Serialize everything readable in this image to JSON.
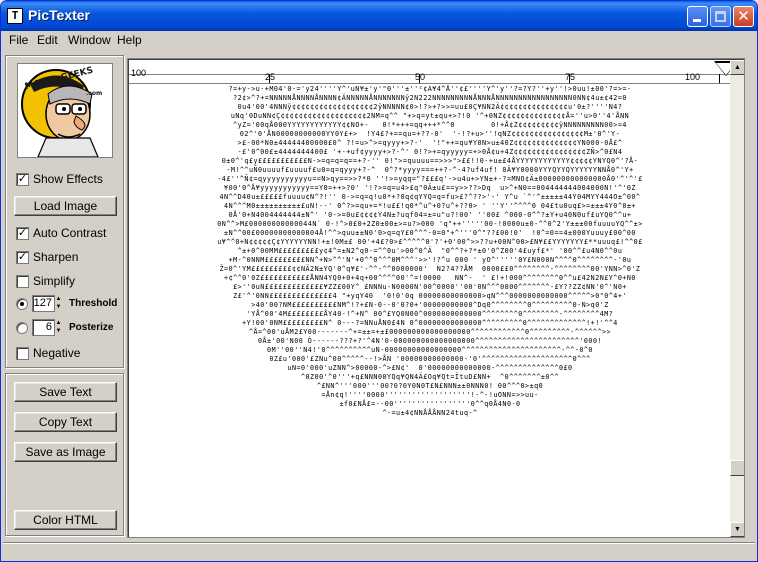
{
  "window": {
    "title": "PicTexter",
    "app_icon_glyph": "T",
    "controls": {
      "close_glyph": "✕"
    }
  },
  "menu": [
    {
      "label": "File"
    },
    {
      "label": "Edit"
    },
    {
      "label": "Window"
    },
    {
      "label": "Help"
    }
  ],
  "logo": {
    "text": "MAJOR GEEKS",
    "suffix": ".com",
    "colors": {
      "ring": "#f2c200",
      "text": "#1a1a1a",
      "face": "#f0c9a0"
    }
  },
  "options": {
    "show_effects": {
      "label": "Show Effects",
      "checked": true
    },
    "load_image": {
      "label": "Load Image"
    },
    "auto_contrast": {
      "label": "Auto Contrast",
      "checked": true
    },
    "sharpen": {
      "label": "Sharpen",
      "checked": true
    },
    "simplify": {
      "label": "Simplify",
      "checked": false
    },
    "threshold": {
      "value": "127",
      "label": "Threshold",
      "selected": true
    },
    "posterize": {
      "value": "6",
      "label": "Posterize",
      "selected": false
    },
    "negative": {
      "label": "Negative",
      "checked": false
    }
  },
  "actions": {
    "save_text": "Save Text",
    "copy_text": "Copy Text",
    "save_as_image": "Save as Image",
    "color_html": "Color HTML"
  },
  "ruler": {
    "labels": [
      "100",
      "25",
      "50",
      "75",
      "100"
    ]
  },
  "ascii_lines": [
    "?=+y->u-+M04'0-='y24''''Y^'uN¥±'y'\"0'''±''²¢Ä¥4^Å''¢£''''Y^'y''?=?Y?''+y''!>0uu!±00'?=>=-",
    "?2¢>^?+=NNNNNÅNNNNÅNNNN¢ÄNNNNNÅNNNNNNNÿ2N222NNNNNNNNNÅNNNÅNNNNNNNNNNNNNNNNN0NN¢4u±¢42=0",
    "0u4'00'4NNNÿ¢¢¢¢¢¢¢¢¢¢¢¢¢¢¢¢¢¢2ÿNNNNN¢0>!?>+?>>=uu£0Ç¥NN2Ä¢¢¢¢¢¢¢¢¢¢¢¢¢¢¢u'0±?''''N4?",
    "uNq'0DuNN¢Ç¢¢¢¢¢¢¢¢¢¢¢¢¢¢¢¢¢¢¢2NM=q^^ \"+>q=yt±qu+>?!0 '^+0NZ¢¢¢¢¢¢¢¢¢¢¢¢¢¢Å=''u>0''4'ÅNN",
    "^yZ='00qÅ000YYYYYYYYYYYY¢¢NO+-   0!*+++=qq+++*^^0        0!+Å¢Z¢¢¢¢¢¢¢¢¢ÿNNNNNNNNN00>=4",
    "02^'0'ÅN00000000000YY0Y£+>  !Y4£?+==qu=+??-0'  '-!?+u>''!qNZ¢¢¢¢¢¢¢¢¢¢¢¢¢¢¢¢M±'0^'Y-",
    ">£-00*N0±44444400000£0^ ?!=u>^>=qyyy+>?-'  '!\"++=qu¥Y0N>u±40Z¢¢¢¢¢¢¢¢¢¢¢¢¢¢YN000-0Å£^",
    "-£'0^00£±4444444400£ '+-+uf¢yyyy+>?-^' 0!?>+=qyyyyy=+>0Å¢u+4Z¢¢¢¢¢¢¢¢¢¢¢¢¢¢¢¢ZÑ>^0£N4",
    "0±0^'q£y£££££££££££N->=q=q=q==+?-'' 0!\">=quuuu==>>>\">££!!0-+u±£4ÅYYYYYYYYYYYY¢¢¢¢¢YNYQ0^'?Å-",
    "-M!^^uÑ0uuuuf£uuuuf£u0=q=qyyy+?-^  0^?*yyyy===++?-^-4?uf4uf! 0Ä¥Y0000YYYQYYQYYYYYYNNÅ0^'Y+",
    "-4£''^Ñ¢=qyyyyyyyyyyu==N>qy==>>?*0 ''!>=yqq=\"?£££q'->u4u+>YN±+-?=MNO¢Ä±000000000000000Å0'^'^'£",
    "¥00'0^Å¥yyyyyyyyyyy==Y0=++>?0' '!?>=q=u4>£q\"0Ä±u£==y>>??>Dq  u>^+N0==004444444004000N!'^'0Z",
    "4N^^D40u±£££££fuuuu¢N^?!'' 0->=q=q!u0*+?0q¢qYYQ=q=fu>£?^??>'-' Y^u `^'^±±±±±44Y04MYY444O±^00^",
    "4N^^^M0±±±±±±±±±±£uN!--' 0^?>=qu+=*!u££!q0*^u^+0?u^+??0> ' ''Y''^^^^0 04£tu0uq£>=±±±4Y0^0±+",
    "0Å'0+N4004444444±N^' '0->=0u£¢¢¢¢Y4N±?uqf04=±=u\"u?!00' ''00£ ^000-0^^?±Y+u40N0uf£uYQ0^^u+",
    "0N^^>M£00000000000044N` 0-!^>0£0+2Z0±00±>=u?>000 'q\"++'''''00-!0000u±0-^^0^2'Y±±±00fuuuuYQ^^±>",
    "±N^^00£00000000000004Å!^^>quu±±N0'0>q=qY£0^^^-0=0\"+^'''0^\"??£00!0'  !0^=0==4±000Yuuuy£00^00",
    "u¥^^0+N¢¢¢¢¢Ç¢YYYYYYNN!+±!0M±£ 00'+4£?0>£^^^^^0'?'+0'00^>>??u+00N^00>£N¥££YYYYYYY£**uuuq£!^^0£",
    "^±+0^00MM£££££££££y¢4^=±N2^q0-=^^0u'>00^0^Ä  \"0^^?+?*±0'0^Z00'4£uyf£*' '00^^£u4N0^^0u",
    "+M-^0NNM£££££££££NN^+N>^^'N'+0^^0^^^0M^^^'>>'!?^u 000 ' yO^'''''0Y£N000N^^^^0^^^^^^^^-'0u",
    "Ž=0^'YM£££££££££¢¢NÄ2N±YQ'0^q¥£'-^^-^^0000000'  N2?4??ÅM  0000££0^^^^^^^^-^^^^^^^^00'YNN>^0'Z",
    "+¢^^0'0Z£££££££££££ÅNN4YQ0+0+4q+00^^^^00'^=!0000   NN^-  ' £!+!000^^^^^^^^0^^u£42N2N£Y^0+N0",
    "£>''0uN£££££££££££££¥ZZ£00Y^ £NNNu-N0000N'00^0000''00'0N^^^0000^^^^^^^-£Y??ZZ¢NN'0^'N0+",
    "Z£'^'0NN££££££££££££££4 \"+yqY40  '0!0'0q 00000000000000>qN^^^0000000000000^^^^^>0\"0^4+'",
    ">40'00?NM££££££££££NM^!?+£N-0--0'0?0+'00000000000^Dq0^^^^^^^^0^^^^^^^^^0-N>q0'Z",
    "'YÅ^00'4M££££££££ÅY40-!^+N^ 00^£YQ0N00^0000000000000^^^^^^^^0^^^^^^^^-^^^^^^^^4M?",
    "+Y!00'0NM£££££££££N^ 0---?=NNuÅN0£4N 0^00000000000000^^^^^^^^^0^^^^^^^^^^^^^!+!'^^4",
    "^Å=^00'uÅM2£Y00-------^+=±±=+±£000000000000000000^^^^^^^^^^^^0^^^^^^^^^-^^^^^^>>",
    "0Å±'00'N00 Ò------???+?'^4N'0-000000000000000000^^^^^^^^^^^^^^^^^^^^^^^'000!",
    "0M''00''N4!'0^^^^^^^^^^uN-00000000000000000^^^^^^^^^^^^^^^^^^^^^^-^^-0^0",
    "0Z£u'000'£ZNu^00^^^^^--!>ÅN '00000000000000-'0'^^^^^^^^^^^^^^^^^^^^0^^^",
    "uN=0'000'uZNN^>00000-^>£N¢'  0'00000000000000-^^^^^^^^^^^^^^0£0",
    "^0Z00'^0'''+q£NNN00YQq¥QN4Ä£Oq¥Qt=ÏtuD£NN+  ^0^^^^^^^±0^^",
    "^£NN^'''000'''00?0?0Y0N0T£N£NNN±±0NNN0! 00^^^0>±q0",
    "=Ån¢q!''''0000'''''''''''''''''''!-^-!uONN=>>uu-",
    "±f0£NÅ£=--00'''''''''''''''''0^^q0Å4N0-0",
    "^-=u±4¢NNÅÅÅNN24tuq-^"
  ]
}
